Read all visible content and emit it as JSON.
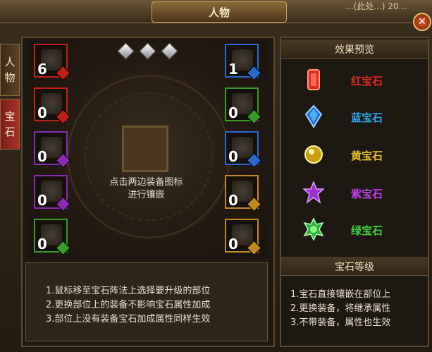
{
  "window": {
    "title": "人物",
    "top_right_text": "...(此处...) 20..."
  },
  "side_tabs": [
    {
      "label_top": "人",
      "label_bottom": "物"
    },
    {
      "label_top": "宝",
      "label_bottom": "石"
    }
  ],
  "colors": {
    "red": "#c0201a",
    "green": "#3a9a2a",
    "purple": "#8a2ab0",
    "blue": "#2a6ad0",
    "orange": "#c08a20"
  },
  "left_slots": [
    {
      "count": "6",
      "border": "red",
      "gem": "red",
      "icon": "sword-icon"
    },
    {
      "count": "0",
      "border": "red",
      "gem": "red",
      "icon": "necklace-icon"
    },
    {
      "count": "0",
      "border": "purple",
      "gem": "purple",
      "icon": "ring-icon"
    },
    {
      "count": "0",
      "border": "purple",
      "gem": "purple",
      "icon": "bracelet-icon"
    },
    {
      "count": "0",
      "border": "green",
      "gem": "green",
      "icon": "boots-icon"
    }
  ],
  "right_slots": [
    {
      "count": "1",
      "border": "blue",
      "gem": "blue",
      "icon": "armor-icon"
    },
    {
      "count": "0",
      "border": "green",
      "gem": "green",
      "icon": "helmet-icon"
    },
    {
      "count": "0",
      "border": "blue",
      "gem": "blue",
      "icon": "belt-icon"
    },
    {
      "count": "0",
      "border": "orange",
      "gem": "orange",
      "icon": "gloves-icon"
    },
    {
      "count": "0",
      "border": "orange",
      "gem": "orange",
      "icon": "pants-icon"
    }
  ],
  "center_hint": {
    "line1": "点击两边装备图标",
    "line2": "进行镶嵌"
  },
  "tips": [
    "1.鼠标移至宝石阵法上选择要升级的部位",
    "2.更换部位上的装备不影响宝石属性加成",
    "3.部位上没有装备宝石加成属性同样生效"
  ],
  "preview": {
    "header": "效果预览",
    "gems": [
      {
        "label": "红宝石",
        "color": "#e02a22",
        "icon": "red-gem-icon"
      },
      {
        "label": "蓝宝石",
        "color": "#2aa8e8",
        "icon": "blue-gem-icon"
      },
      {
        "label": "黄宝石",
        "color": "#e8c020",
        "icon": "yellow-gem-icon"
      },
      {
        "label": "紫宝石",
        "color": "#c040e8",
        "icon": "purple-gem-icon"
      },
      {
        "label": "绿宝石",
        "color": "#40d040",
        "icon": "green-gem-icon"
      }
    ]
  },
  "level": {
    "header": "宝石等级",
    "tips": [
      "1.宝石直接镶嵌在部位上",
      "2.更换装备，将继承属性",
      "3.不带装备，属性也生效"
    ]
  }
}
